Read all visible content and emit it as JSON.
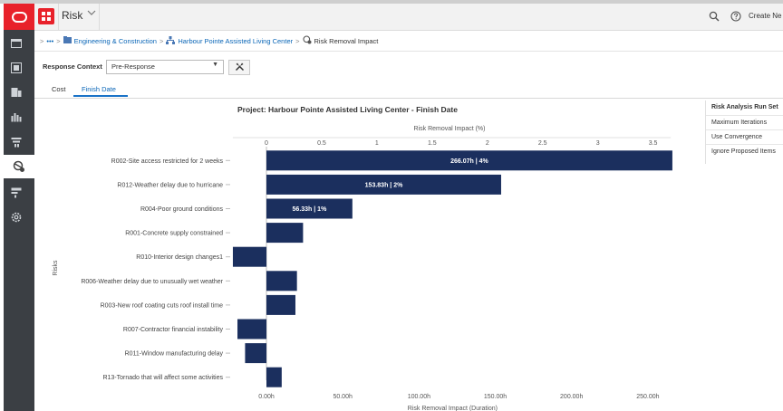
{
  "app": {
    "title": "Risk",
    "create_label": "Create Ne"
  },
  "sidebar": {
    "items": [
      {
        "icon": "home-icon"
      },
      {
        "icon": "portfolio-icon"
      },
      {
        "icon": "projects-icon"
      },
      {
        "icon": "dashboard-icon"
      },
      {
        "icon": "filter-icon"
      },
      {
        "icon": "risk-analysis-icon",
        "active": true
      },
      {
        "icon": "templates-icon"
      },
      {
        "icon": "settings-icon"
      }
    ]
  },
  "breadcrumb": {
    "ellipsis": "•••",
    "items": [
      "Engineering & Construction",
      "Harbour Pointe Assisted Living Center",
      "Risk Removal Impact"
    ]
  },
  "context": {
    "label": "Response Context",
    "value": "Pre-Response"
  },
  "tabs": [
    "Cost",
    "Finish Date"
  ],
  "right_panel": {
    "title": "Risk Analysis Run Set",
    "rows": [
      "Maximum Iterations",
      "Use Convergence",
      "Ignore Proposed Items"
    ]
  },
  "colors": {
    "bar": "#1b2f5e",
    "accent": "#0a66b7",
    "brand": "#e8212a"
  },
  "chart_data": {
    "type": "bar",
    "orientation": "horizontal",
    "title": "Project: Harbour Pointe Assisted Living Center - Finish Date",
    "top_axis_label": "Risk Removal Impact (%)",
    "xlabel": "Risk Removal Impact (Duration)",
    "ylabel": "Risks",
    "xlim": [
      -22,
      265
    ],
    "x_ticks": [
      0,
      50,
      100,
      150,
      200,
      250
    ],
    "x_tick_labels": [
      "0.00h",
      "50.00h",
      "100.00h",
      "150.00h",
      "200.00h",
      "250.00h"
    ],
    "top_ticks": [
      0,
      0.5,
      1,
      1.5,
      2,
      2.5,
      3,
      3.5
    ],
    "top_tick_labels": [
      "0",
      "0.5",
      "1",
      "1.5",
      "2",
      "2.5",
      "3",
      "3.5"
    ],
    "top_units_per_percent": 72.4,
    "categories": [
      "R002-Site access restricted for 2 weeks",
      "R012-Weather delay due to hurricane",
      "R004-Poor ground conditions",
      "R001-Concrete supply constrained",
      "R010-Interior design changes1",
      "R006-Weather delay due to unusually wet weather",
      "R003-New roof coating cuts roof install time",
      "R007-Contractor financial instability",
      "R011-Window manufacturing delay",
      "R13-Tornado that will affect some activities"
    ],
    "values": [
      266.07,
      153.83,
      56.33,
      24,
      -22,
      20,
      19,
      -19,
      -14,
      10
    ],
    "data_labels": [
      "266.07h | 4%",
      "153.83h | 2%",
      "56.33h | 1%",
      "",
      "",
      "",
      "",
      "",
      "",
      ""
    ],
    "grid": false,
    "legend": "none"
  }
}
